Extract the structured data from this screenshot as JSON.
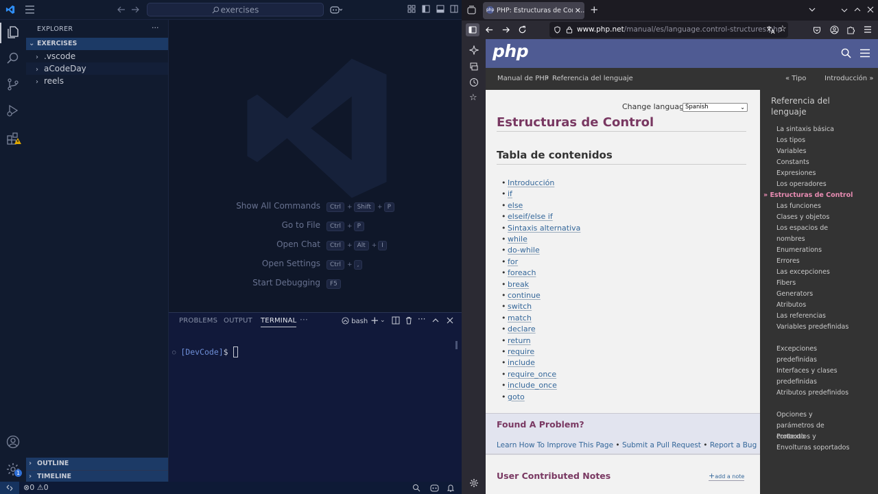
{
  "vscode": {
    "search_placeholder": "exercises",
    "explorer_title": "EXPLORER",
    "explorer_more": "···",
    "workspace": "EXERCISES",
    "tree": [
      {
        "label": ".vscode"
      },
      {
        "label": "aCodeDay"
      },
      {
        "label": "reels"
      }
    ],
    "outline": "OUTLINE",
    "timeline": "TIMELINE",
    "account_badge": "1",
    "commands": [
      {
        "label": "Show All Commands",
        "keys": [
          "Ctrl",
          "Shift",
          "P"
        ]
      },
      {
        "label": "Go to File",
        "keys": [
          "Ctrl",
          "P"
        ]
      },
      {
        "label": "Open Chat",
        "keys": [
          "Ctrl",
          "Alt",
          "I"
        ]
      },
      {
        "label": "Open Settings",
        "keys": [
          "Ctrl",
          ","
        ]
      },
      {
        "label": "Start Debugging",
        "keys": [
          "F5"
        ]
      }
    ],
    "panel_tabs": {
      "problems": "PROBLEMS",
      "output": "OUTPUT",
      "terminal": "TERMINAL",
      "more": "···"
    },
    "terminal_shell": "bash",
    "prompt": "[DevCode]",
    "prompt_symbol": "$",
    "status": {
      "errors": "0",
      "warnings": "0"
    },
    "colors": {
      "accent": "#3794ff",
      "selection": "#1c3a66"
    }
  },
  "firefox": {
    "tab_title": "PHP: Estructuras de Contr...",
    "url_host": "www.php.net",
    "url_path": "/manual/es/language.control-structures.php",
    "php": {
      "logo": "php",
      "breadcrumb": [
        "Manual de PHP",
        "Referencia del lenguaje"
      ],
      "breadcrumb_sep": "›",
      "prev_link": "« Tipo",
      "next_link": "Introducción »",
      "change_language_label": "Change language:",
      "language": "Spanish",
      "page_title": "Estructuras de Control",
      "toc_title": "Tabla de contenidos",
      "toc": [
        "Introducción",
        "if",
        "else",
        "elseif/else if",
        "Sintaxis alternativa",
        "while",
        "do-while",
        "for",
        "foreach",
        "break",
        "continue",
        "switch",
        "match",
        "declare",
        "return",
        "require",
        "include",
        "require_once",
        "include_once",
        "goto"
      ],
      "problem_title": "Found A Problem?",
      "problem_links": [
        "Learn How To Improve This Page",
        "Submit a Pull Request",
        "Report a Bug"
      ],
      "problem_sep": "•",
      "notes_title": "User Contributed Notes",
      "add_note": "add a note",
      "sidebar_title": "Referencia del lenguaje",
      "sidebar": [
        "La sintaxis básica",
        "Los tipos",
        "Variables",
        "Constants",
        "Expresiones",
        "Los operadores",
        "» Estructuras de Control",
        "Las funciones",
        "Clases y objetos",
        "Los espacios de nombres",
        "Enumerations",
        "Errores",
        "Las excepciones",
        "Fibers",
        "Generators",
        "Atributos",
        "Las referencias",
        "Variables predefinidas",
        "Excepciones predefinidas",
        "Interfaces y clases predefinidas",
        "Atributos predefinidos",
        "Opciones y parámetros de contexto",
        "Protocolos y Envolturas soportados"
      ],
      "colors": {
        "header": "#4f5b93",
        "title": "#793862",
        "link": "#336699",
        "active": "#e98cb3"
      }
    }
  }
}
